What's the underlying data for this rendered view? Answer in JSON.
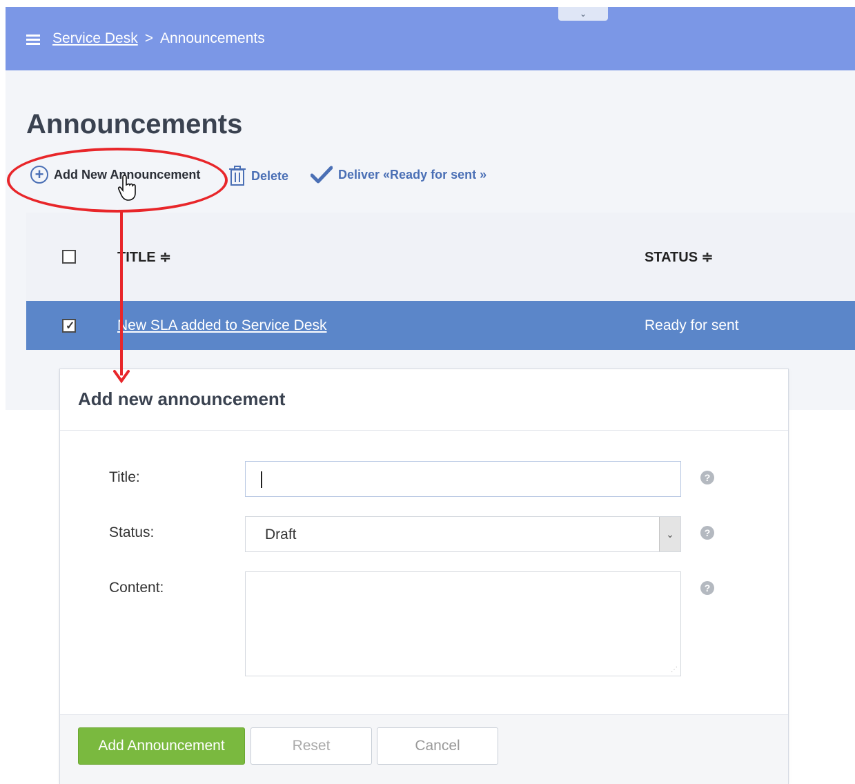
{
  "header": {
    "breadcrumb_root": "Service Desk",
    "breadcrumb_separator": ">",
    "breadcrumb_current": "Announcements",
    "collapse_glyph": "⌄"
  },
  "page": {
    "title": "Announcements"
  },
  "toolbar": {
    "add_label": "Add New Announcement",
    "delete_label": "Delete",
    "deliver_label": "Deliver «Ready for sent »"
  },
  "table": {
    "columns": [
      "TITLE ≑",
      "STATUS ≑"
    ],
    "rows": [
      {
        "title": "New SLA added to Service Desk",
        "status": "Ready for sent",
        "selected": true
      }
    ]
  },
  "dialog": {
    "title": "Add new announcement",
    "fields": {
      "title_label": "Title:",
      "title_value": "",
      "status_label": "Status:",
      "status_value": "Draft",
      "content_label": "Content:",
      "content_value": ""
    },
    "buttons": {
      "add": "Add Announcement",
      "reset": "Reset",
      "cancel": "Cancel"
    }
  },
  "colors": {
    "header_bg": "#7b97e6",
    "selected_row": "#5b86c9",
    "primary_button": "#7ab93f",
    "annotation": "#e8262a"
  },
  "icons": [
    "menu-icon",
    "add-circle-icon",
    "trash-icon",
    "check-icon",
    "help-icon",
    "chevron-down-icon",
    "hand-cursor-icon"
  ]
}
